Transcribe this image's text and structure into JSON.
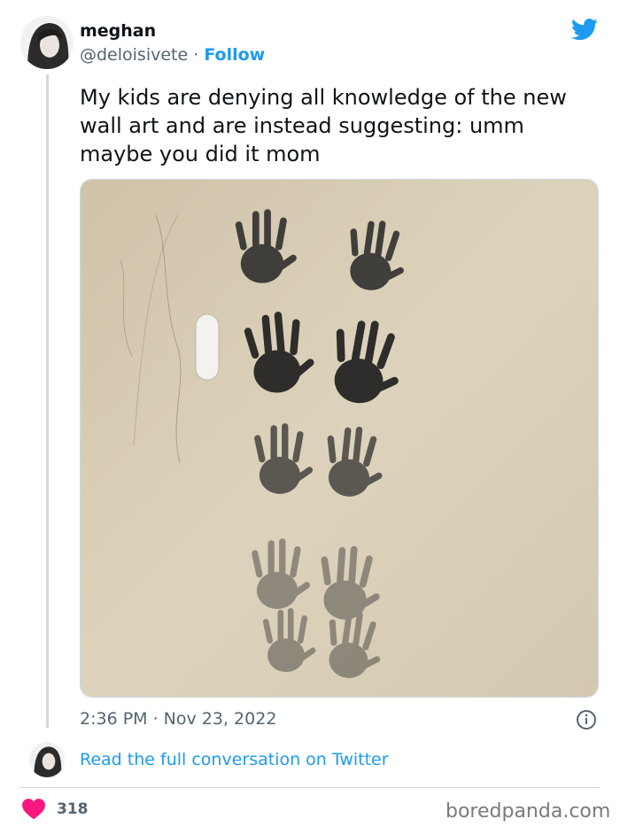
{
  "tweet": {
    "author_name": "meghan",
    "handle": "@deloisivete",
    "separator": "·",
    "follow_label": "Follow",
    "text": "My kids are denying all knowledge of the new wall art and are instead suggesting: umm maybe you did it mom",
    "timestamp": "2:36 PM · Nov 23, 2022",
    "conversation_link": "Read the full conversation on Twitter",
    "like_count": "318"
  },
  "footer": {
    "source": "boredpanda.com"
  },
  "colors": {
    "twitter_blue": "#1d9bf0",
    "heart_pink": "#f91880",
    "secondary_text": "#536471",
    "wall": "#d7ccb4"
  },
  "icons": {
    "brand": "twitter-bird-icon",
    "info": "info-icon",
    "like": "heart-icon"
  }
}
